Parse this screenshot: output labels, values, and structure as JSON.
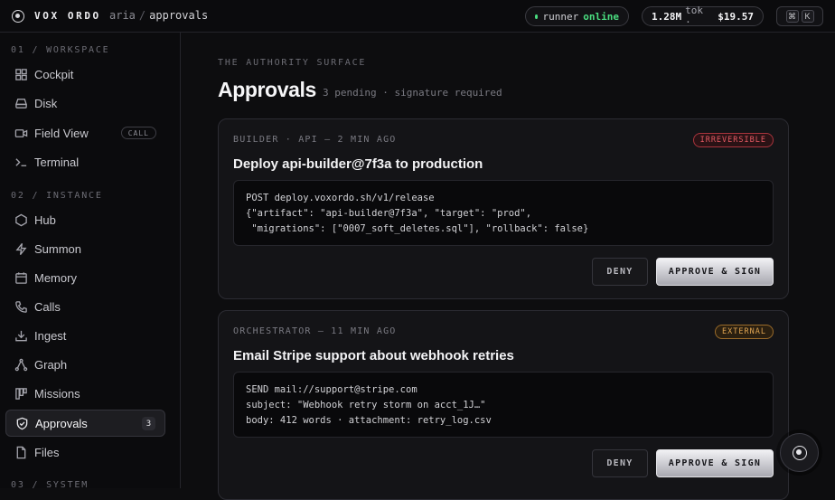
{
  "topbar": {
    "brand": "VOX ORDO",
    "crumb_parent": "aria",
    "crumb_sep": "/",
    "crumb_current": "approvals",
    "runner_label": "runner",
    "runner_status": "online",
    "tokens": "1.28M",
    "tokens_unit": "tok ·",
    "cost": "$19.57",
    "shortcut_keys": [
      "⌘",
      "K"
    ]
  },
  "sidebar": {
    "sections": [
      {
        "heading": "01 / WORKSPACE"
      },
      {
        "heading": "02 / INSTANCE"
      },
      {
        "heading": "03 / SYSTEM"
      }
    ],
    "items": [
      {
        "label": "Cockpit",
        "icon": "grid-icon"
      },
      {
        "label": "Disk",
        "icon": "disk-icon"
      },
      {
        "label": "Field View",
        "icon": "video-icon",
        "tag": "CALL"
      },
      {
        "label": "Terminal",
        "icon": "terminal-icon"
      },
      {
        "label": "Hub",
        "icon": "hexagon-icon"
      },
      {
        "label": "Summon",
        "icon": "bolt-icon"
      },
      {
        "label": "Memory",
        "icon": "calendar-icon"
      },
      {
        "label": "Calls",
        "icon": "phone-icon"
      },
      {
        "label": "Ingest",
        "icon": "download-icon"
      },
      {
        "label": "Graph",
        "icon": "graph-icon"
      },
      {
        "label": "Missions",
        "icon": "kanban-icon"
      },
      {
        "label": "Approvals",
        "icon": "shield-check-icon",
        "count": "3",
        "active": true
      },
      {
        "label": "Files",
        "icon": "file-icon"
      }
    ]
  },
  "main": {
    "eyebrow": "THE AUTHORITY SURFACE",
    "title": "Approvals",
    "subtitle": "3 pending · signature required",
    "cards": [
      {
        "meta": "BUILDER · API — 2 MIN AGO",
        "badge": "IRREVERSIBLE",
        "title": "Deploy api-builder@7f3a to production",
        "code": "POST deploy.voxordo.sh/v1/release\n{\"artifact\": \"api-builder@7f3a\", \"target\": \"prod\",\n \"migrations\": [\"0007_soft_deletes.sql\"], \"rollback\": false}",
        "deny": "DENY",
        "approve": "APPROVE & SIGN"
      },
      {
        "meta": "ORCHESTRATOR — 11 MIN AGO",
        "badge": "EXTERNAL",
        "title": "Email Stripe support about webhook retries",
        "code": "SEND mail://support@stripe.com\nsubject: \"Webhook retry storm on acct_1J…\"\nbody: 412 words · attachment: retry_log.csv",
        "deny": "DENY",
        "approve": "APPROVE & SIGN"
      }
    ]
  },
  "colors": {
    "accent_online": "#4ade80",
    "badge_irreversible": "#e45a63",
    "badge_external": "#e0a552"
  }
}
